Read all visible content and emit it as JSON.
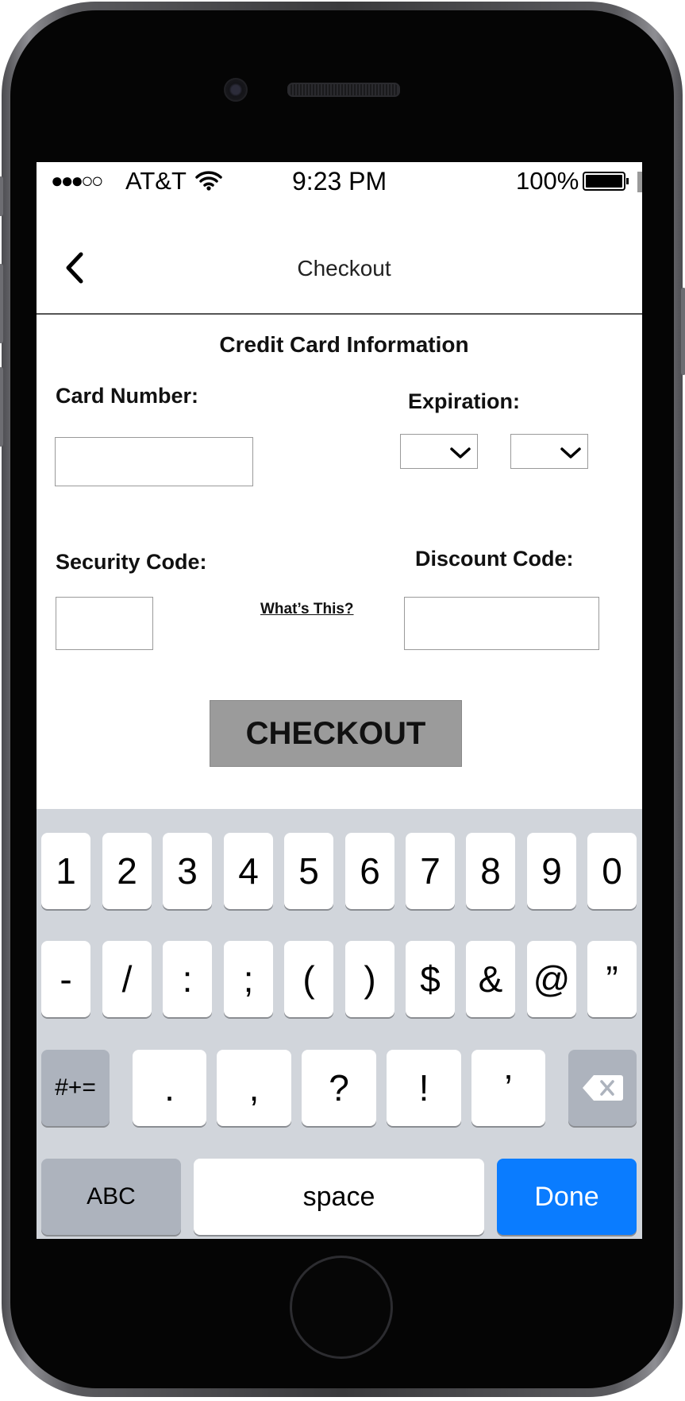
{
  "status_bar": {
    "signal": "●●●○○",
    "carrier": "AT&T",
    "time": "9:23 PM",
    "battery": "100%"
  },
  "nav": {
    "back_icon": "chevron-left-icon",
    "title": "Checkout"
  },
  "form": {
    "section_title": "Credit Card Information",
    "card_number_label": "Card Number:",
    "card_number_value": "",
    "expiration_label": "Expiration:",
    "expiration_month": "",
    "expiration_year": "",
    "security_code_label": "Security Code:",
    "security_code_value": "",
    "whats_this_link": "What’s This?",
    "discount_code_label": "Discount Code:",
    "discount_code_value": "",
    "checkout_button": "CHECKOUT"
  },
  "keyboard": {
    "row1": [
      "1",
      "2",
      "3",
      "4",
      "5",
      "6",
      "7",
      "8",
      "9",
      "0"
    ],
    "row2": [
      "-",
      "/",
      ":",
      ";",
      "(",
      ")",
      "$",
      "&",
      "@",
      "”"
    ],
    "shift_key": "#+=",
    "row3": [
      ".",
      ",",
      "?",
      "!",
      "’"
    ],
    "abc_key": "ABC",
    "space_key": "space",
    "done_key": "Done",
    "done_color": "#0a7cff"
  }
}
